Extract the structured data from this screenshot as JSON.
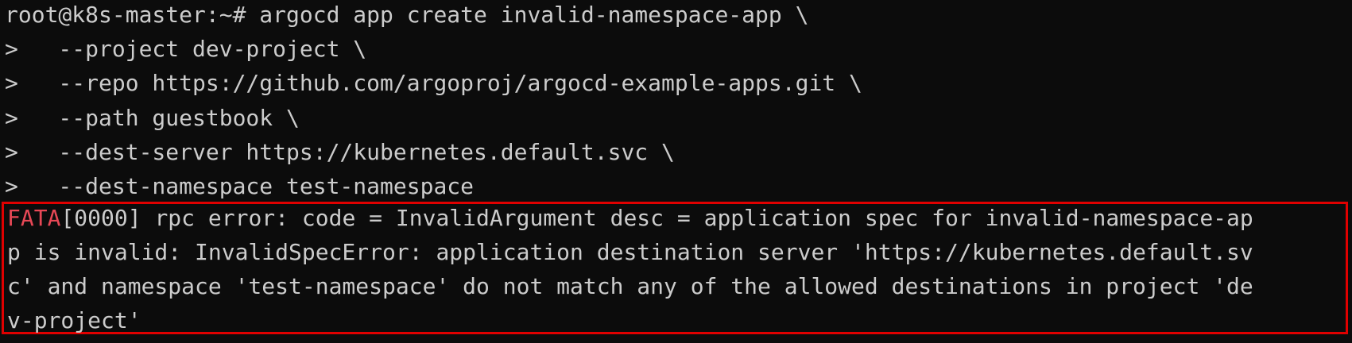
{
  "terminal": {
    "lines": [
      "root@k8s-master:~# argocd app create invalid-namespace-app \\",
      ">   --project dev-project \\",
      ">   --repo https://github.com/argoproj/argocd-example-apps.git \\",
      ">   --path guestbook \\",
      ">   --dest-server https://kubernetes.default.svc \\",
      ">   --dest-namespace test-namespace"
    ],
    "error": {
      "level": "FATA",
      "lines": [
        "[0000] rpc error: code = InvalidArgument desc = application spec for invalid-namespace-ap",
        "p is invalid: InvalidSpecError: application destination server 'https://kubernetes.default.sv",
        "c' and namespace 'test-namespace' do not match any of the allowed destinations in project 'de",
        "v-project'"
      ]
    }
  },
  "colors": {
    "background": "#0c0c0c",
    "text": "#cccccc",
    "fata": "#e74856",
    "highlight_border": "#e00000"
  }
}
